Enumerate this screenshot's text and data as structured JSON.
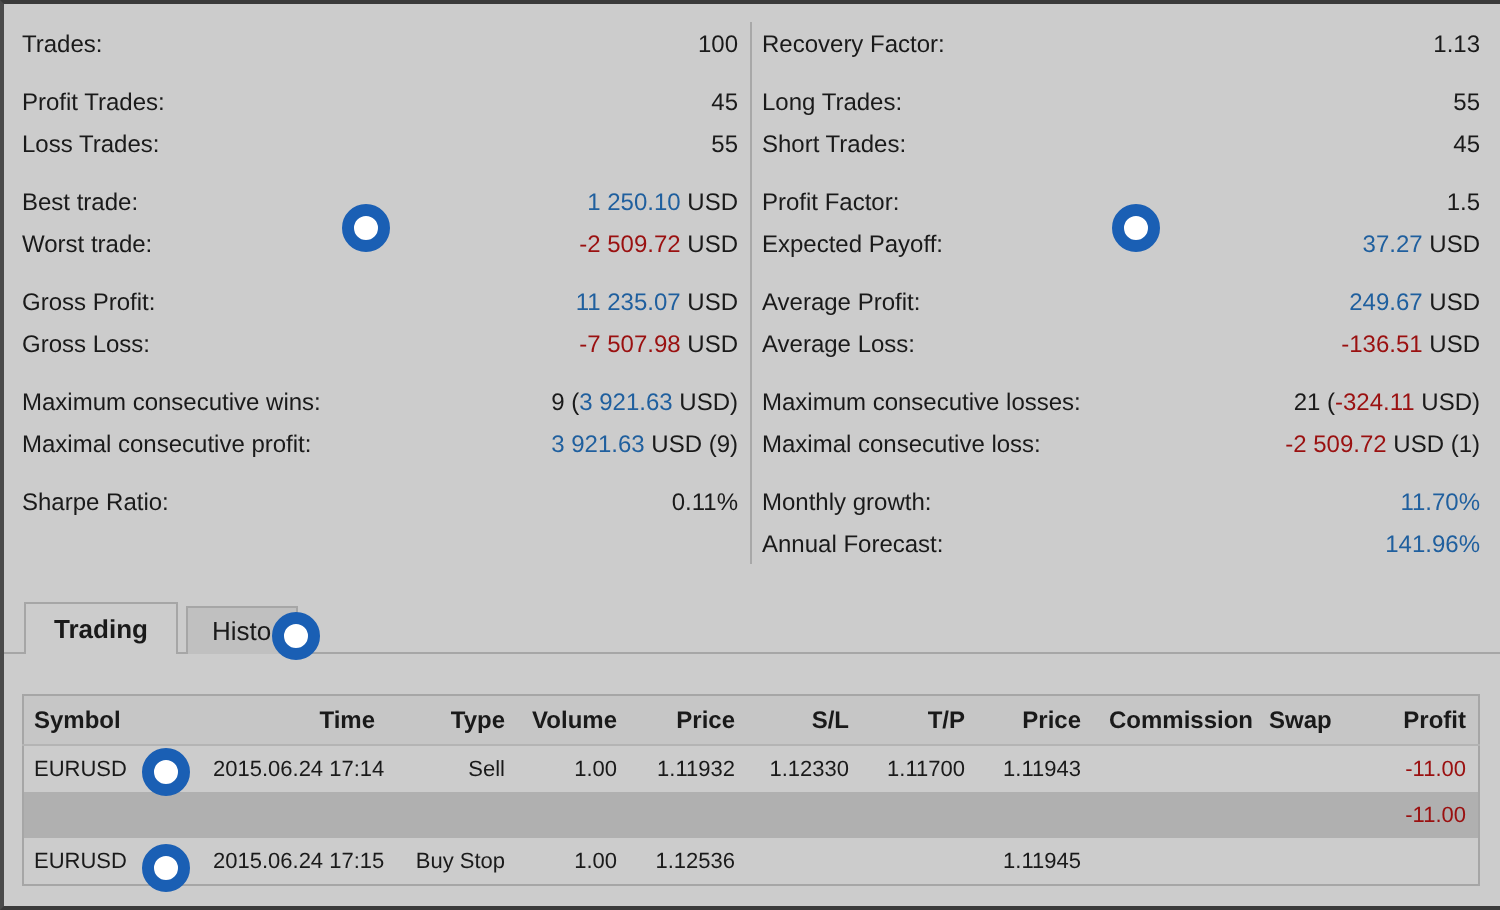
{
  "stats_left": [
    [
      {
        "label": "Trades:",
        "value": [
          {
            "text": "100"
          }
        ]
      }
    ],
    [
      {
        "label": "Profit Trades:",
        "value": [
          {
            "text": "45"
          }
        ]
      },
      {
        "label": "Loss Trades:",
        "value": [
          {
            "text": "55"
          }
        ]
      }
    ],
    [
      {
        "label": "Best trade:",
        "value": [
          {
            "text": "1 250.10",
            "color": "#1f5f9e"
          },
          {
            "text": " USD"
          }
        ]
      },
      {
        "label": "Worst trade:",
        "value": [
          {
            "text": "-2 509.72",
            "color": "#9a1010"
          },
          {
            "text": " USD"
          }
        ]
      }
    ],
    [
      {
        "label": "Gross Profit:",
        "value": [
          {
            "text": "11 235.07",
            "color": "#1f5f9e"
          },
          {
            "text": " USD"
          }
        ]
      },
      {
        "label": "Gross Loss:",
        "value": [
          {
            "text": "-7 507.98",
            "color": "#9a1010"
          },
          {
            "text": " USD"
          }
        ]
      }
    ],
    [
      {
        "label": "Maximum consecutive wins:",
        "value": [
          {
            "text": "9 ("
          },
          {
            "text": "3 921.63",
            "color": "#1f5f9e"
          },
          {
            "text": " USD)"
          }
        ]
      },
      {
        "label": "Maximal consecutive profit:",
        "value": [
          {
            "text": "3 921.63",
            "color": "#1f5f9e"
          },
          {
            "text": " USD (9)"
          }
        ]
      }
    ],
    [
      {
        "label": "Sharpe Ratio:",
        "value": [
          {
            "text": "0.11%"
          }
        ]
      }
    ]
  ],
  "stats_right": [
    [
      {
        "label": "Recovery Factor:",
        "value": [
          {
            "text": "1.13"
          }
        ]
      }
    ],
    [
      {
        "label": "Long Trades:",
        "value": [
          {
            "text": "55"
          }
        ]
      },
      {
        "label": "Short Trades:",
        "value": [
          {
            "text": "45"
          }
        ]
      }
    ],
    [
      {
        "label": "Profit Factor:",
        "value": [
          {
            "text": "1.5"
          }
        ]
      },
      {
        "label": "Expected Payoff:",
        "value": [
          {
            "text": "37.27",
            "color": "#1f5f9e"
          },
          {
            "text": " USD"
          }
        ]
      }
    ],
    [
      {
        "label": "Average Profit:",
        "value": [
          {
            "text": "249.67",
            "color": "#1f5f9e"
          },
          {
            "text": " USD"
          }
        ]
      },
      {
        "label": "Average Loss:",
        "value": [
          {
            "text": "-136.51",
            "color": "#9a1010"
          },
          {
            "text": " USD"
          }
        ]
      }
    ],
    [
      {
        "label": "Maximum consecutive losses:",
        "value": [
          {
            "text": "21 ("
          },
          {
            "text": "-324.11",
            "color": "#9a1010"
          },
          {
            "text": " USD)"
          }
        ]
      },
      {
        "label": "Maximal consecutive loss:",
        "value": [
          {
            "text": "-2 509.72",
            "color": "#9a1010"
          },
          {
            "text": " USD (1)"
          }
        ]
      }
    ],
    [
      {
        "label": "Monthly growth:",
        "value": [
          {
            "text": "11.70%",
            "color": "#1f5f9e"
          }
        ]
      },
      {
        "label": "Annual Forecast:",
        "value": [
          {
            "text": "141.96%",
            "color": "#1f5f9e"
          }
        ]
      }
    ]
  ],
  "tabs": [
    {
      "label": "Trading",
      "selected": true
    },
    {
      "label": "Histo",
      "selected": false
    }
  ],
  "table": {
    "columns": [
      "Symbol",
      "Time",
      "Type",
      "Volume",
      "Price",
      "S/L",
      "T/P",
      "Price",
      "Commission",
      "Swap",
      "Profit"
    ],
    "rows": [
      {
        "kind": "trade",
        "cells": [
          "EURUSD",
          "2015.06.24 17:14",
          "Sell",
          "1.00",
          "1.11932",
          "1.12330",
          "1.11700",
          "1.11943",
          null,
          null,
          "-11.00"
        ],
        "color": "#9a1010"
      },
      {
        "kind": "total",
        "cells": [
          null,
          null,
          null,
          null,
          null,
          null,
          null,
          null,
          null,
          null,
          "-11.00"
        ],
        "color": "#9a1010"
      },
      {
        "kind": "trade",
        "cells": [
          "EURUSD",
          "2015.06.24 17:15",
          "Buy Stop",
          "1.00",
          "1.12536",
          null,
          null,
          "1.11945",
          null,
          null,
          null
        ]
      }
    ]
  }
}
